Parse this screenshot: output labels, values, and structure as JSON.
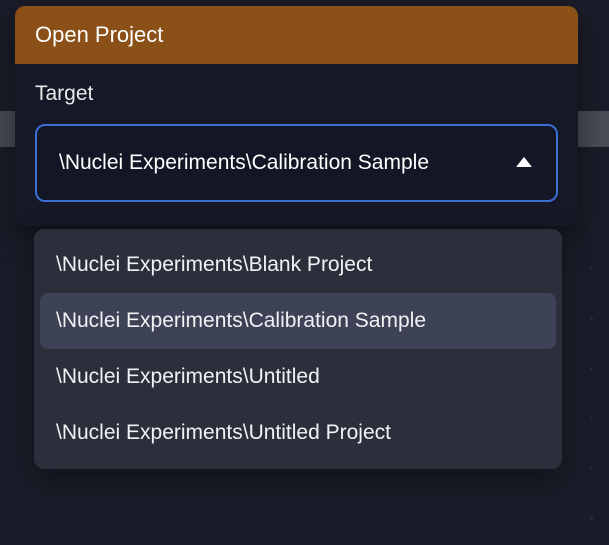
{
  "dialog": {
    "title": "Open Project",
    "field_label": "Target"
  },
  "select": {
    "value": "\\Nuclei Experiments\\Calibration Sample"
  },
  "options": [
    {
      "label": "\\Nuclei Experiments\\Blank Project"
    },
    {
      "label": "\\Nuclei Experiments\\Calibration Sample"
    },
    {
      "label": "\\Nuclei Experiments\\Untitled"
    },
    {
      "label": "\\Nuclei Experiments\\Untitled Project"
    }
  ],
  "selected_index": 1
}
